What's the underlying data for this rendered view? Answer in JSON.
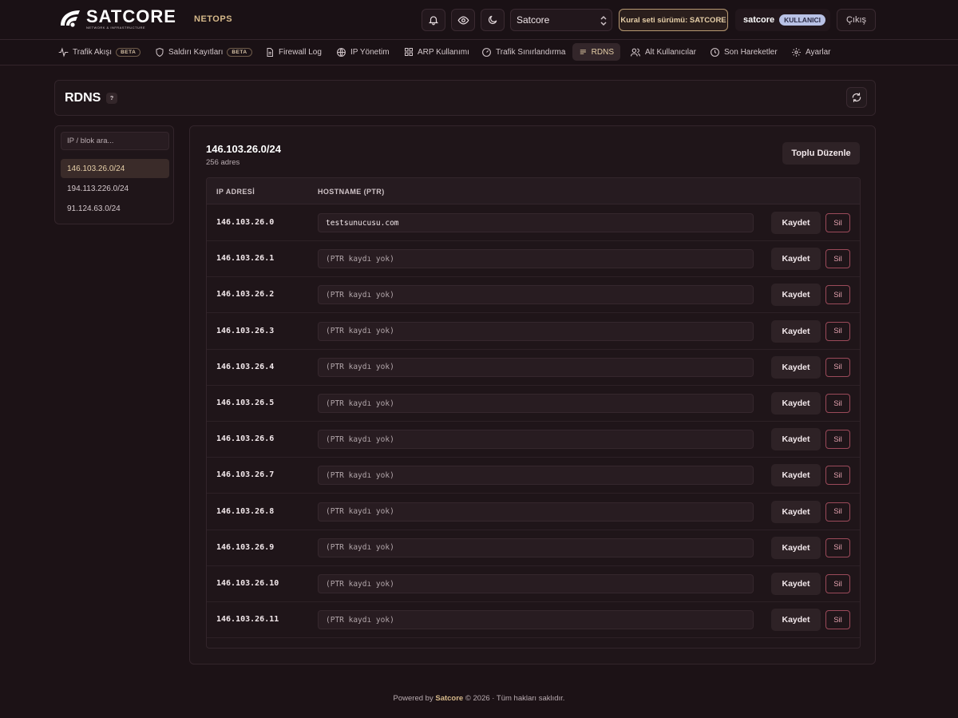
{
  "header": {
    "brand_name": "SATCORE",
    "brand_tagline": "NETWORK & INFRASTRUCTURE",
    "module": "NETOPS",
    "tenant_select": "Satcore",
    "ruleset_label": "Kural seti sürümü: SATCORE",
    "user_name": "satcore",
    "user_role": "KULLANICI",
    "logout_label": "Çıkış"
  },
  "nav": {
    "items": [
      {
        "label": "Trafik Akışı",
        "badge": "BETA"
      },
      {
        "label": "Saldırı Kayıtları",
        "badge": "BETA"
      },
      {
        "label": "Firewall Log"
      },
      {
        "label": "IP Yönetim"
      },
      {
        "label": "ARP Kullanımı"
      },
      {
        "label": "Trafik Sınırlandırma"
      },
      {
        "label": "RDNS"
      },
      {
        "label": "Alt Kullanıcılar"
      },
      {
        "label": "Son Hareketler"
      },
      {
        "label": "Ayarlar"
      }
    ]
  },
  "page": {
    "title": "RDNS",
    "help": "?"
  },
  "sidebar": {
    "search_placeholder": "IP / blok ara...",
    "blocks": [
      "146.103.26.0/24",
      "194.113.226.0/24",
      "91.124.63.0/24"
    ]
  },
  "main": {
    "block_title": "146.103.26.0/24",
    "block_count": "256 adres",
    "bulk_edit_label": "Toplu Düzenle",
    "col_ip": "IP ADRESİ",
    "col_host": "HOSTNAME (PTR)",
    "save_label": "Kaydet",
    "delete_label": "Sil",
    "rows": [
      {
        "ip": "146.103.26.0",
        "host": "testsunucusu.com",
        "placeholder": ""
      },
      {
        "ip": "146.103.26.1",
        "host": "",
        "placeholder": "(PTR kaydı yok)"
      },
      {
        "ip": "146.103.26.2",
        "host": "",
        "placeholder": "(PTR kaydı yok)"
      },
      {
        "ip": "146.103.26.3",
        "host": "",
        "placeholder": "(PTR kaydı yok)"
      },
      {
        "ip": "146.103.26.4",
        "host": "",
        "placeholder": "(PTR kaydı yok)"
      },
      {
        "ip": "146.103.26.5",
        "host": "",
        "placeholder": "(PTR kaydı yok)"
      },
      {
        "ip": "146.103.26.6",
        "host": "",
        "placeholder": "(PTR kaydı yok)"
      },
      {
        "ip": "146.103.26.7",
        "host": "",
        "placeholder": "(PTR kaydı yok)"
      },
      {
        "ip": "146.103.26.8",
        "host": "",
        "placeholder": "(PTR kaydı yok)"
      },
      {
        "ip": "146.103.26.9",
        "host": "",
        "placeholder": "(PTR kaydı yok)"
      },
      {
        "ip": "146.103.26.10",
        "host": "",
        "placeholder": "(PTR kaydı yok)"
      },
      {
        "ip": "146.103.26.11",
        "host": "",
        "placeholder": "(PTR kaydı yok)"
      }
    ]
  },
  "footer": {
    "prefix": "Powered by",
    "brand": "Satcore",
    "suffix": "© 2026 · Tüm hakları saklıdır."
  }
}
